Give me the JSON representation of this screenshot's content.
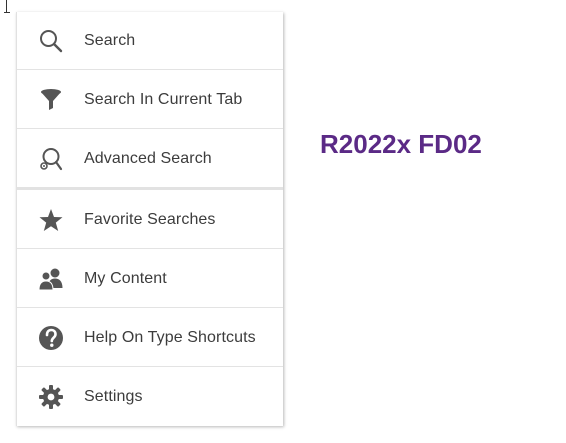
{
  "menu": {
    "items": [
      {
        "label": "Search",
        "icon": "search-icon"
      },
      {
        "label": "Search In Current Tab",
        "icon": "filter-icon"
      },
      {
        "label": "Advanced Search",
        "icon": "advanced-search-icon"
      },
      {
        "label": "Favorite Searches",
        "icon": "star-icon"
      },
      {
        "label": "My Content",
        "icon": "users-icon"
      },
      {
        "label": "Help On Type Shortcuts",
        "icon": "help-icon"
      },
      {
        "label": "Settings",
        "icon": "gear-icon"
      }
    ]
  },
  "version": {
    "text": "R2022x FD02",
    "color": "#5b2a86"
  },
  "colors": {
    "icon": "#555555",
    "text": "#3c3c3c",
    "divider": "#e3e3e3"
  }
}
